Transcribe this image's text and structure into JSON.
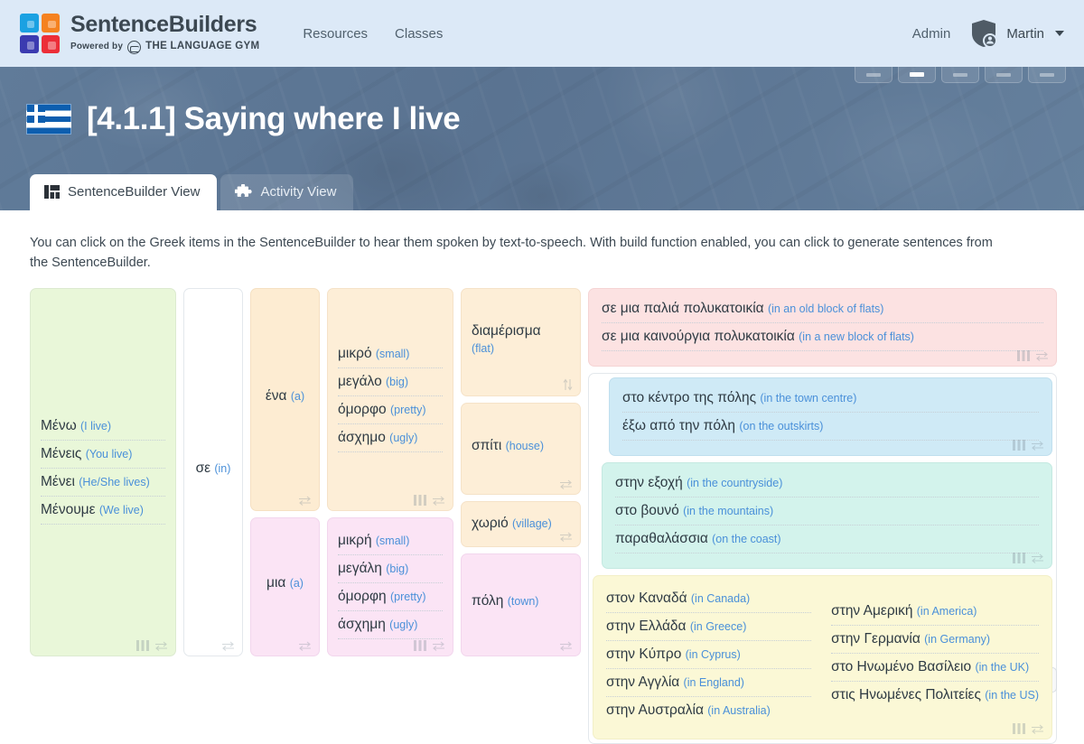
{
  "navbar": {
    "brand_name": "SentenceBuilders",
    "brand_powered": "Powered by",
    "brand_gym": "THE LANGUAGE GYM",
    "links": [
      {
        "label": "Resources"
      },
      {
        "label": "Classes"
      }
    ],
    "admin_label": "Admin",
    "user_name": "Martin"
  },
  "header": {
    "flag": "greek-flag",
    "title": "[4.1.1] Saying where I live",
    "tabs": [
      {
        "label": "SentenceBuilder View",
        "icon": "layout-icon",
        "active": true
      },
      {
        "label": "Activity View",
        "icon": "puzzle-icon",
        "active": false
      }
    ]
  },
  "main": {
    "intro": "You can click on the Greek items in the SentenceBuilder to hear them spoken by text-to-speech. With build function enabled, you can click to generate sentences from the SentenceBuilder."
  },
  "sentence_builder": {
    "col1": {
      "color": "green",
      "items": [
        {
          "gr": "Μένω",
          "en": "(I live)"
        },
        {
          "gr": "Μένεις",
          "en": "(You live)"
        },
        {
          "gr": "Μένει",
          "en": "(He/She lives)"
        },
        {
          "gr": "Μένουμε",
          "en": "(We live)"
        }
      ]
    },
    "col2": {
      "color": "white",
      "items": [
        {
          "gr": "σε",
          "en": "(in)"
        }
      ]
    },
    "col3": {
      "blocks": [
        {
          "color": "orange",
          "items": [
            {
              "gr": "ένα",
              "en": "(a)"
            }
          ]
        },
        {
          "color": "pinkl",
          "items": [
            {
              "gr": "μια",
              "en": "(a)"
            }
          ]
        }
      ]
    },
    "col4": {
      "blocks": [
        {
          "color": "cream",
          "items": [
            {
              "gr": "μικρό",
              "en": "(small)"
            },
            {
              "gr": "μεγάλο",
              "en": "(big)"
            },
            {
              "gr": "όμορφο",
              "en": "(pretty)"
            },
            {
              "gr": "άσχημο",
              "en": "(ugly)"
            }
          ]
        },
        {
          "color": "pinkl",
          "items": [
            {
              "gr": "μικρή",
              "en": "(small)"
            },
            {
              "gr": "μεγάλη",
              "en": "(big)"
            },
            {
              "gr": "όμορφη",
              "en": "(pretty)"
            },
            {
              "gr": "άσχημη",
              "en": "(ugly)"
            }
          ]
        }
      ]
    },
    "col5": {
      "blocks": [
        {
          "color": "cream",
          "items": [
            {
              "gr": "διαμέρισμα",
              "en": "(flat)"
            }
          ]
        },
        {
          "color": "cream",
          "items": [
            {
              "gr": "σπίτι",
              "en": "(house)"
            }
          ]
        },
        {
          "color": "cream",
          "items": [
            {
              "gr": "χωριό",
              "en": "(village)"
            }
          ]
        },
        {
          "color": "pinkl",
          "items": [
            {
              "gr": "πόλη",
              "en": "(town)"
            }
          ]
        }
      ]
    },
    "col6": {
      "blocks": [
        {
          "color": "rose",
          "items": [
            {
              "gr": "σε μια παλιά πολυκατοικία",
              "en": "(in an old block of flats)"
            },
            {
              "gr": "σε μια καινούργια πολυκατοικία",
              "en": "(in a new block of flats)"
            }
          ]
        },
        {
          "color": "sky",
          "items": [
            {
              "gr": "στο κέντρο της πόλης",
              "en": "(in the town centre)"
            },
            {
              "gr": "έξω από την πόλη",
              "en": "(on the outskirts)"
            }
          ]
        },
        {
          "color": "mint",
          "items": [
            {
              "gr": "στην εξοχή",
              "en": "(in the countryside)"
            },
            {
              "gr": "στο βουνό",
              "en": "(in the mountains)"
            },
            {
              "gr": "παραθαλάσσια",
              "en": "(on the coast)"
            }
          ]
        },
        {
          "color": "lemon",
          "left": [
            {
              "gr": "στον Καναδά",
              "en": "(in Canada)"
            },
            {
              "gr": "στην Ελλάδα",
              "en": "(in Greece)"
            },
            {
              "gr": "στην Κύπρο",
              "en": "(in Cyprus)"
            },
            {
              "gr": "στην Αγγλία",
              "en": "(in England)"
            },
            {
              "gr": "στην Αυστραλία",
              "en": "(in Australia)"
            }
          ],
          "right": [
            {
              "gr": "στην Αμερική",
              "en": "(in America)"
            },
            {
              "gr": "στην Γερμανία",
              "en": "(in Germany)"
            },
            {
              "gr": "στο Ηνωμένο Βασίλειο",
              "en": "(in the UK)"
            },
            {
              "gr": "στις Ηνωμένες Πολιτείες",
              "en": "(in the US)"
            }
          ]
        }
      ]
    }
  },
  "toolbar": {
    "buttons": [
      {
        "icon": "gauge-icon"
      },
      {
        "icon": "music-note-icon"
      },
      {
        "icon": "printer-icon"
      },
      {
        "icon": "document-icon"
      },
      {
        "icon": "graduation-cap-icon"
      },
      {
        "icon": "fullscreen-icon"
      }
    ]
  },
  "colors": {
    "navbar_bg": "#dce9f7",
    "banner_bg": "#5b7593",
    "translation_blue": "#4a90d9",
    "greek_text": "#2e3a43"
  }
}
